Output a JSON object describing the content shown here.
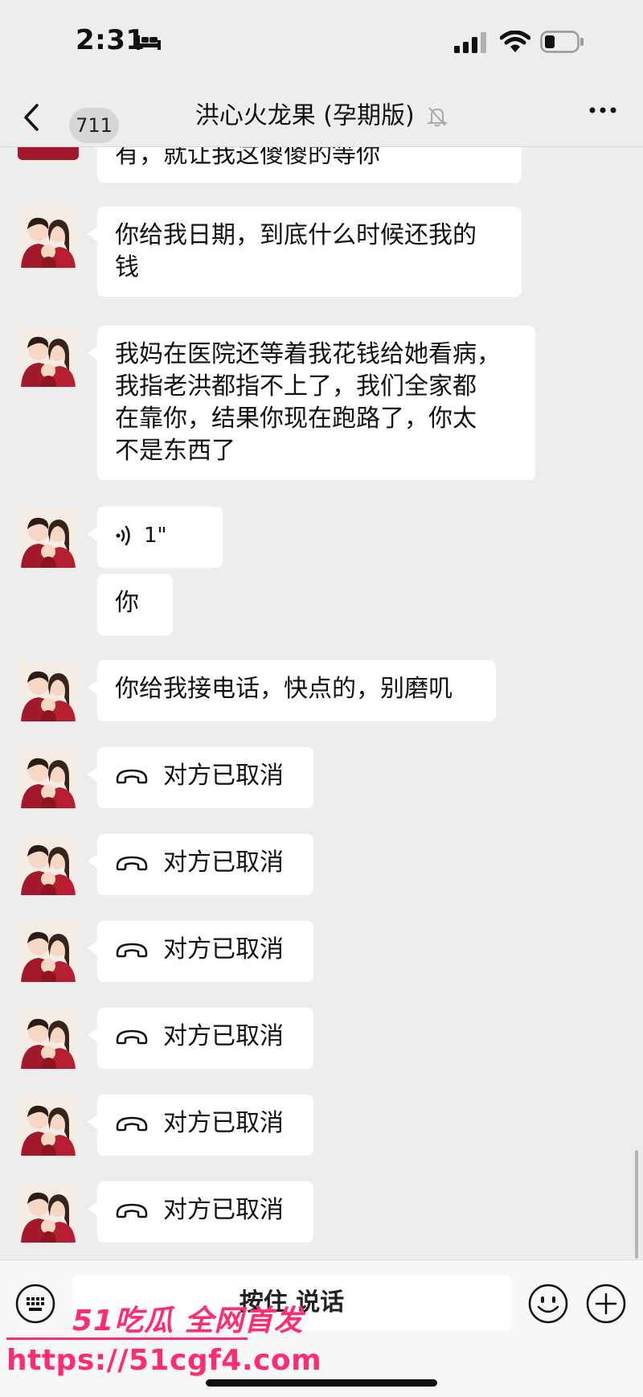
{
  "status": {
    "time": "2:31"
  },
  "header": {
    "back_count": "711",
    "title": "洪心火龙果 (孕期版)"
  },
  "messages": [
    {
      "type": "text",
      "lines": [
        "有，就让我这傻傻的等你"
      ],
      "avatar": false
    },
    {
      "type": "text",
      "lines": [
        "你给我日期，到底什么时候还我的",
        "钱"
      ],
      "avatar": true
    },
    {
      "type": "text",
      "lines": [
        "我妈在医院还等着我花钱给她看病，",
        "我指老洪都指不上了，我们全家都",
        "在靠你，结果你现在跑路了，你太",
        "不是东西了"
      ],
      "avatar": true
    },
    {
      "type": "voice",
      "duration": "1\"",
      "avatar": true
    },
    {
      "type": "text",
      "lines": [
        "你"
      ],
      "avatar": false
    },
    {
      "type": "text",
      "lines": [
        "你给我接电话，快点的，别磨叽"
      ],
      "avatar": true
    },
    {
      "type": "call",
      "text": "对方已取消",
      "avatar": true
    },
    {
      "type": "call",
      "text": "对方已取消",
      "avatar": true
    },
    {
      "type": "call",
      "text": "对方已取消",
      "avatar": true
    },
    {
      "type": "call",
      "text": "对方已取消",
      "avatar": true
    },
    {
      "type": "call",
      "text": "对方已取消",
      "avatar": true
    },
    {
      "type": "call",
      "text": "对方已取消",
      "avatar": true
    }
  ],
  "input": {
    "hold_to_talk": "按住 说话"
  },
  "watermark": {
    "line1": "51吃瓜 全网首发",
    "line2": "https://51cgf4.com"
  },
  "colors": {
    "accent": "#ff2d6f",
    "background": "#ededed",
    "bubble": "#ffffff"
  }
}
